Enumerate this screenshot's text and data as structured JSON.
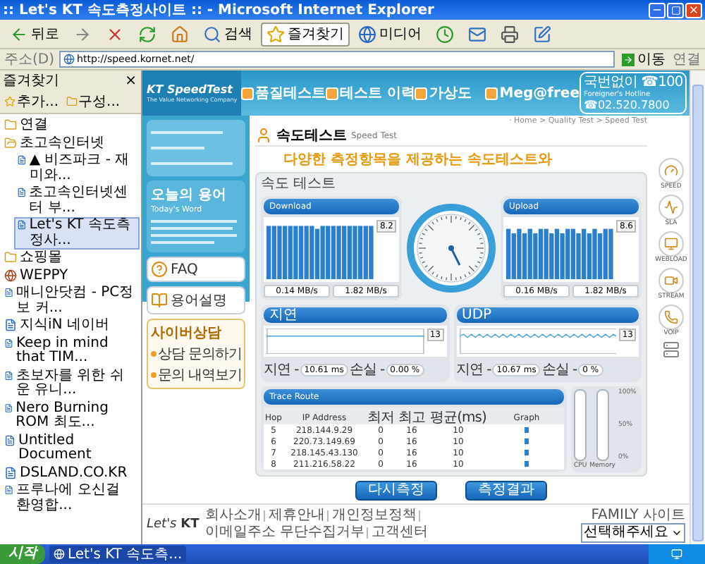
{
  "window": {
    "title": ":: Let's KT 속도측정사이트 :: - Microsoft Internet Explorer"
  },
  "toolbar": [
    {
      "kind": "back",
      "label": "뒤로",
      "pressed": false
    },
    {
      "kind": "forward",
      "pressed": false
    },
    {
      "kind": "stop",
      "pressed": false
    },
    {
      "kind": "refresh",
      "pressed": false
    },
    {
      "kind": "home",
      "pressed": false
    },
    {
      "kind": "search",
      "label": "검색",
      "pressed": false
    },
    {
      "kind": "favorites",
      "label": "즐겨찾기",
      "pressed": true
    },
    {
      "kind": "media",
      "label": "미디어",
      "pressed": false
    },
    {
      "kind": "history",
      "pressed": false
    },
    {
      "kind": "mail",
      "pressed": false
    },
    {
      "kind": "print",
      "pressed": false
    },
    {
      "kind": "edit",
      "pressed": false
    }
  ],
  "address_bar": {
    "label": "주소(D)",
    "url": "http://speed.kornet.net/",
    "go": "이동",
    "links": "연결"
  },
  "favorites": {
    "title": "즐겨찾기",
    "close": "×",
    "add": "추가...",
    "organize": "구성...",
    "items": [
      {
        "kind": "folder",
        "label": "연결",
        "expanded": false,
        "selected": false
      },
      {
        "kind": "folder",
        "label": "초고속인터넷",
        "expanded": true,
        "selected": false,
        "children": [
          {
            "kind": "page",
            "label": "▲ 비즈파크 - 재미와...",
            "selected": false
          },
          {
            "kind": "page",
            "label": "초고속인터넷센터 부...",
            "selected": false
          },
          {
            "kind": "page",
            "label": "Let's KT 속도측정사...",
            "selected": true
          }
        ]
      },
      {
        "kind": "folder",
        "label": "쇼핑몰",
        "expanded": false,
        "selected": false
      },
      {
        "kind": "site",
        "label": "WEPPY",
        "selected": false
      },
      {
        "kind": "page",
        "label": "매니안닷컴 - PC정보 커...",
        "selected": false
      },
      {
        "kind": "page",
        "label": "지식iN 네이버",
        "selected": false
      },
      {
        "kind": "page",
        "label": "Keep in mind that TIM...",
        "selected": false
      },
      {
        "kind": "page",
        "label": "초보자를 위한 쉬운 유니...",
        "selected": false
      },
      {
        "kind": "page",
        "label": "Nero Burning ROM 최도...",
        "selected": false
      },
      {
        "kind": "page",
        "label": "Untitled Document",
        "selected": false
      },
      {
        "kind": "page",
        "label": "DSLAND.CO.KR",
        "selected": false
      },
      {
        "kind": "page",
        "label": "프루나에 오신걸 환영합...",
        "selected": false
      }
    ]
  },
  "page": {
    "header": {
      "logo": "KT SpeedTest",
      "tagline": "The Value Networking Company",
      "nav": [
        {
          "label": "품질테스트"
        },
        {
          "label": "테스트 이력"
        },
        {
          "label": "가상도"
        },
        {
          "label": "Meg@free"
        }
      ],
      "hotline": {
        "line1": "국번없이 ☎100",
        "line2": "Foreigner's Hotline",
        "line3": "☎02.520.7800"
      }
    },
    "left_nav": {
      "word_title": "오늘의 용어",
      "word_subtitle": "Today's Word",
      "links": [
        {
          "kind": "faq",
          "title": "FAQ"
        },
        {
          "kind": "glossary",
          "title": "용어설명"
        }
      ],
      "consult": {
        "title": "사이버상담",
        "items": [
          "상담 문의하기",
          "문의 내역보기"
        ]
      }
    },
    "content": {
      "breadcrumb": "· Home > Quality Test > Speed Test",
      "title": "속도테스트",
      "title_en": "Speed Test",
      "headline": "다양한 측정항목을 제공하는 속도테스트와",
      "test": {
        "title": "속도 테스트",
        "download": {
          "label": "Download",
          "peak": "8.2",
          "readings": [
            "0.14 MB/s",
            "1.82 MB/s"
          ]
        },
        "upload": {
          "label": "Upload",
          "peak": "8.6",
          "readings": [
            "0.16 MB/s",
            "1.82 MB/s"
          ]
        },
        "latency": [
          {
            "kind": "flat",
            "label": "지연",
            "peak": "13",
            "stats": [
              {
                "label": "지연 -",
                "value": "10.61 ms"
              },
              {
                "label": "손실 -",
                "value": "0.00 %"
              }
            ]
          },
          {
            "kind": "wave",
            "label": "UDP",
            "peak": "13",
            "stats": [
              {
                "label": "지연 -",
                "value": "10.67 ms"
              },
              {
                "label": "손실 -",
                "value": "0 %"
              }
            ]
          }
        ],
        "trace": {
          "title": "Trace Route",
          "columns": [
            "Hop",
            "IP Address",
            "최저",
            "최고",
            "평균(ms)",
            "Graph"
          ],
          "rows": [
            [
              "5",
              "218.144.9.29",
              "0",
              "16",
              "10"
            ],
            [
              "6",
              "220.73.149.69",
              "0",
              "16",
              "10"
            ],
            [
              "7",
              "218.145.43.130",
              "0",
              "16",
              "10"
            ],
            [
              "8",
              "211.216.58.22",
              "0",
              "16",
              "10"
            ]
          ]
        },
        "system": {
          "meters": [
            {
              "label": "CPU",
              "level": 0
            },
            {
              "label": "Memory",
              "level": 0
            }
          ],
          "ticks": [
            "100%",
            "50%",
            "0%"
          ]
        },
        "buttons": [
          "다시측정",
          "측정결과"
        ]
      }
    },
    "right_tools": [
      {
        "label": "SPEED"
      },
      {
        "label": "SLA"
      },
      {
        "label": "WEBLOAD"
      },
      {
        "label": "STREAM"
      },
      {
        "label": "VOIP"
      }
    ],
    "footer": {
      "logo_a": "Let's",
      "logo_b": "KT",
      "links": [
        "회사소개",
        "제휴안내",
        "개인정보정책",
        "이메일주소 무단수집거부",
        "고객센터"
      ],
      "family_label": "FAMILY 사이트",
      "family_select": "선택해주세요"
    }
  },
  "taskbar": {
    "start": "시작",
    "tasks": [
      {
        "label": "Let's KT 속도측...",
        "selected": true
      }
    ]
  }
}
